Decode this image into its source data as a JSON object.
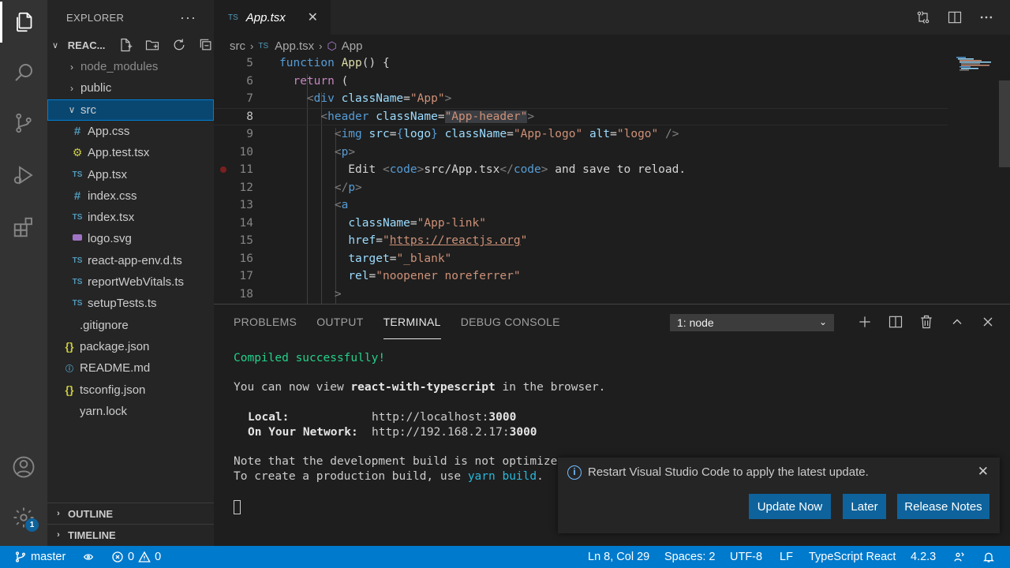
{
  "activity_bar": {
    "icons": [
      "files-icon",
      "search-icon",
      "source-control-icon",
      "run-debug-icon",
      "extensions-icon",
      "account-icon",
      "gear-icon"
    ],
    "settings_badge": "1"
  },
  "sidebar": {
    "title": "EXPLORER",
    "more": "···",
    "project_name": "REAC...",
    "tree": [
      {
        "name": "node_modules",
        "type": "folder",
        "expanded": false,
        "dim": true
      },
      {
        "name": "public",
        "type": "folder",
        "expanded": false
      },
      {
        "name": "src",
        "type": "folder",
        "expanded": true,
        "selected": true
      },
      {
        "name": "App.css",
        "type": "css"
      },
      {
        "name": "App.test.tsx",
        "type": "test"
      },
      {
        "name": "App.tsx",
        "type": "ts"
      },
      {
        "name": "index.css",
        "type": "css"
      },
      {
        "name": "index.tsx",
        "type": "ts"
      },
      {
        "name": "logo.svg",
        "type": "svg"
      },
      {
        "name": "react-app-env.d.ts",
        "type": "ts"
      },
      {
        "name": "reportWebVitals.ts",
        "type": "ts"
      },
      {
        "name": "setupTests.ts",
        "type": "ts"
      },
      {
        "name": ".gitignore",
        "type": "git"
      },
      {
        "name": "package.json",
        "type": "json"
      },
      {
        "name": "README.md",
        "type": "md"
      },
      {
        "name": "tsconfig.json",
        "type": "json"
      },
      {
        "name": "yarn.lock",
        "type": "lock"
      }
    ],
    "outline_label": "OUTLINE",
    "timeline_label": "TIMELINE"
  },
  "editor": {
    "tab_label": "App.tsx",
    "tab_icon_text": "TS",
    "breadcrumb": {
      "folder": "src",
      "file": "App.tsx",
      "symbol": "App"
    },
    "current_line": 8,
    "breakpoint_line": 11
  },
  "code_lines": [
    {
      "num": "5",
      "parts": [
        {
          "c": "kb",
          "t": "function "
        },
        {
          "c": "fn",
          "t": "App"
        },
        {
          "c": "pl",
          "t": "() {"
        }
      ]
    },
    {
      "num": "6",
      "parts": [
        {
          "c": "pl",
          "t": "  "
        },
        {
          "c": "kw",
          "t": "return"
        },
        {
          "c": "pl",
          "t": " ("
        }
      ]
    },
    {
      "num": "7",
      "parts": [
        {
          "c": "pl",
          "t": "    "
        },
        {
          "c": "tg",
          "t": "<"
        },
        {
          "c": "tn",
          "t": "div"
        },
        {
          "c": "pl",
          "t": " "
        },
        {
          "c": "at",
          "t": "className"
        },
        {
          "c": "pl",
          "t": "="
        },
        {
          "c": "st",
          "t": "\"App\""
        },
        {
          "c": "tg",
          "t": ">"
        }
      ]
    },
    {
      "num": "8",
      "parts": [
        {
          "c": "pl",
          "t": "      "
        },
        {
          "c": "tg",
          "t": "<"
        },
        {
          "c": "tn",
          "t": "header"
        },
        {
          "c": "pl",
          "t": " "
        },
        {
          "c": "at",
          "t": "className"
        },
        {
          "c": "pl",
          "t": "="
        },
        {
          "c": "st hl",
          "t": "\"App-header\""
        },
        {
          "c": "tg",
          "t": ">"
        }
      ]
    },
    {
      "num": "9",
      "parts": [
        {
          "c": "pl",
          "t": "        "
        },
        {
          "c": "tg",
          "t": "<"
        },
        {
          "c": "tn",
          "t": "img"
        },
        {
          "c": "pl",
          "t": " "
        },
        {
          "c": "at",
          "t": "src"
        },
        {
          "c": "pl",
          "t": "="
        },
        {
          "c": "kb",
          "t": "{"
        },
        {
          "c": "at",
          "t": "logo"
        },
        {
          "c": "kb",
          "t": "}"
        },
        {
          "c": "pl",
          "t": " "
        },
        {
          "c": "at",
          "t": "className"
        },
        {
          "c": "pl",
          "t": "="
        },
        {
          "c": "st",
          "t": "\"App-logo\""
        },
        {
          "c": "pl",
          "t": " "
        },
        {
          "c": "at",
          "t": "alt"
        },
        {
          "c": "pl",
          "t": "="
        },
        {
          "c": "st",
          "t": "\"logo\""
        },
        {
          "c": "pl",
          "t": " "
        },
        {
          "c": "tg",
          "t": "/>"
        }
      ]
    },
    {
      "num": "10",
      "parts": [
        {
          "c": "pl",
          "t": "        "
        },
        {
          "c": "tg",
          "t": "<"
        },
        {
          "c": "tn",
          "t": "p"
        },
        {
          "c": "tg",
          "t": ">"
        }
      ]
    },
    {
      "num": "11",
      "parts": [
        {
          "c": "pl",
          "t": "          Edit "
        },
        {
          "c": "tg",
          "t": "<"
        },
        {
          "c": "tn",
          "t": "code"
        },
        {
          "c": "tg",
          "t": ">"
        },
        {
          "c": "pl",
          "t": "src/App.tsx"
        },
        {
          "c": "tg",
          "t": "</"
        },
        {
          "c": "tn",
          "t": "code"
        },
        {
          "c": "tg",
          "t": ">"
        },
        {
          "c": "pl",
          "t": " and save to reload."
        }
      ]
    },
    {
      "num": "12",
      "parts": [
        {
          "c": "pl",
          "t": "        "
        },
        {
          "c": "tg",
          "t": "</"
        },
        {
          "c": "tn",
          "t": "p"
        },
        {
          "c": "tg",
          "t": ">"
        }
      ]
    },
    {
      "num": "13",
      "parts": [
        {
          "c": "pl",
          "t": "        "
        },
        {
          "c": "tg",
          "t": "<"
        },
        {
          "c": "tn",
          "t": "a"
        }
      ]
    },
    {
      "num": "14",
      "parts": [
        {
          "c": "pl",
          "t": "          "
        },
        {
          "c": "at",
          "t": "className"
        },
        {
          "c": "pl",
          "t": "="
        },
        {
          "c": "st",
          "t": "\"App-link\""
        }
      ]
    },
    {
      "num": "15",
      "parts": [
        {
          "c": "pl",
          "t": "          "
        },
        {
          "c": "at",
          "t": "href"
        },
        {
          "c": "pl",
          "t": "="
        },
        {
          "c": "st",
          "t": "\""
        },
        {
          "c": "st ul",
          "t": "https://reactjs.org"
        },
        {
          "c": "st",
          "t": "\""
        }
      ]
    },
    {
      "num": "16",
      "parts": [
        {
          "c": "pl",
          "t": "          "
        },
        {
          "c": "at",
          "t": "target"
        },
        {
          "c": "pl",
          "t": "="
        },
        {
          "c": "st",
          "t": "\"_blank\""
        }
      ]
    },
    {
      "num": "17",
      "parts": [
        {
          "c": "pl",
          "t": "          "
        },
        {
          "c": "at",
          "t": "rel"
        },
        {
          "c": "pl",
          "t": "="
        },
        {
          "c": "st",
          "t": "\"noopener noreferrer\""
        }
      ]
    },
    {
      "num": "18",
      "parts": [
        {
          "c": "pl",
          "t": "        "
        },
        {
          "c": "tg",
          "t": ">"
        }
      ]
    }
  ],
  "panel": {
    "tabs": [
      "PROBLEMS",
      "OUTPUT",
      "TERMINAL",
      "DEBUG CONSOLE"
    ],
    "active_tab": "TERMINAL",
    "terminal_select": "1: node",
    "terminal": {
      "compiled": "Compiled successfully!",
      "view_prefix": "You can now view ",
      "app_name": "react-with-typescript",
      "view_suffix": " in the browser.",
      "local_label": "Local:",
      "local_url_prefix": "http://localhost:",
      "local_port": "3000",
      "network_label": "On Your Network:",
      "network_url_prefix": "http://192.168.2.17:",
      "network_port": "3000",
      "note": "Note that the development build is not optimize",
      "build_prefix": "To create a production build, use ",
      "build_cmd": "yarn build",
      "build_suffix": "."
    }
  },
  "notification": {
    "message": "Restart Visual Studio Code to apply the latest update.",
    "buttons": [
      "Update Now",
      "Later",
      "Release Notes"
    ]
  },
  "status_bar": {
    "branch": "master",
    "errors": "0",
    "warnings": "0",
    "position": "Ln 8, Col 29",
    "spaces": "Spaces: 2",
    "encoding": "UTF-8",
    "eol": "LF",
    "language": "TypeScript React",
    "ts_version": "4.2.3"
  },
  "colors": {
    "accent": "#007acc",
    "button": "#0e639c",
    "terminal_green": "#23d18b"
  }
}
